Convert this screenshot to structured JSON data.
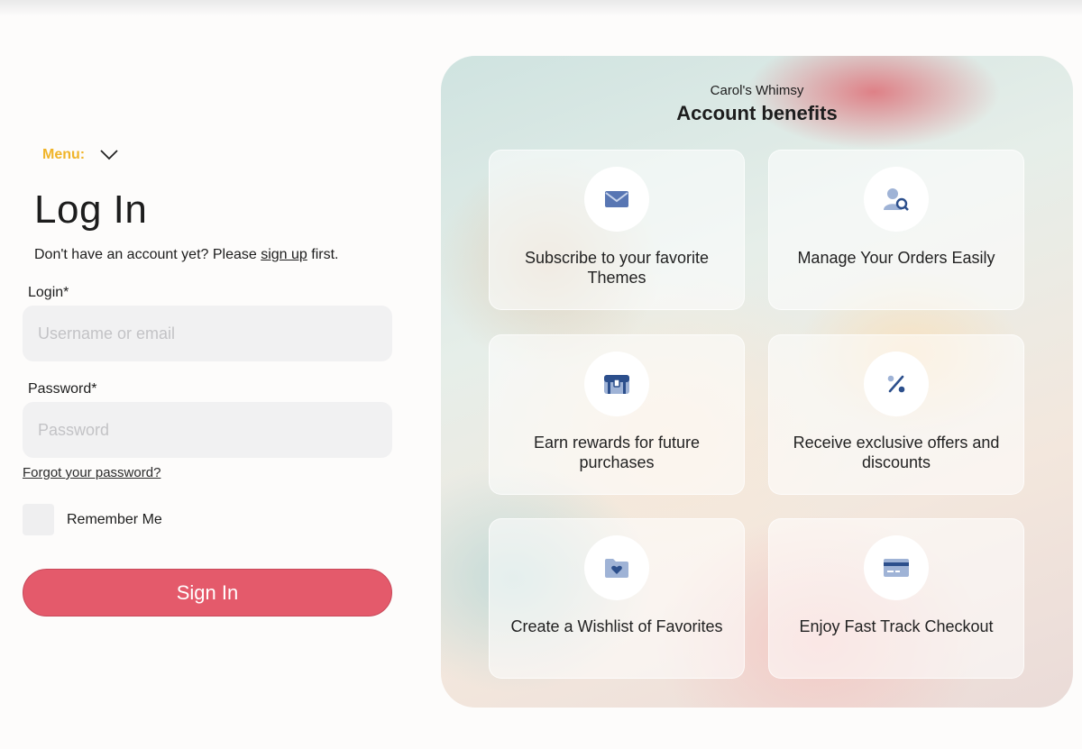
{
  "menu": {
    "label": "Menu:"
  },
  "login": {
    "title": "Log In",
    "signup_prefix": "Don't have an account yet? Please ",
    "signup_link": "sign up",
    "signup_suffix": " first.",
    "login_label": "Login*",
    "login_placeholder": "Username or email",
    "password_label": "Password*",
    "password_placeholder": "Password",
    "forgot_link": "Forgot your password?",
    "remember_label": "Remember Me",
    "signin_button": "Sign In"
  },
  "benefits": {
    "brand": "Carol's Whimsy",
    "title": "Account benefits",
    "cards": [
      {
        "icon": "envelope-icon",
        "text": "Subscribe to your favorite Themes"
      },
      {
        "icon": "user-search-icon",
        "text": "Manage Your Orders Easily"
      },
      {
        "icon": "treasure-chest-icon",
        "text": "Earn rewards for future purchases"
      },
      {
        "icon": "percent-icon",
        "text": "Receive exclusive offers and discounts"
      },
      {
        "icon": "heart-folder-icon",
        "text": "Create a Wishlist of Favorites"
      },
      {
        "icon": "credit-card-icon",
        "text": "Enjoy Fast Track Checkout"
      }
    ]
  },
  "colors": {
    "accent_yellow": "#f0b429",
    "signin_red": "#e45a6b",
    "icon_blue": "#2c4f8c",
    "icon_light_blue": "#9fb3d6"
  }
}
